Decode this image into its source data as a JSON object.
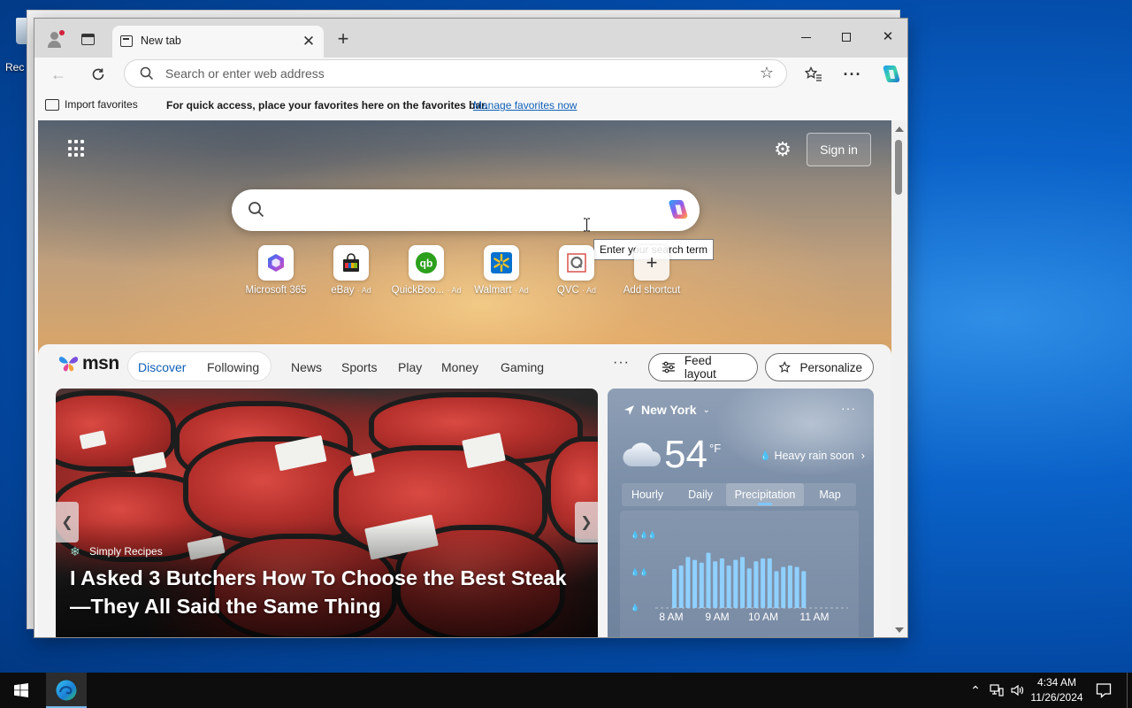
{
  "desktop": {
    "icon_label": "Rec"
  },
  "browser": {
    "tab_title": "New tab",
    "address_placeholder": "Search or enter web address",
    "favorites_bar": {
      "import_label": "Import favorites",
      "message": "For quick access, place your favorites here on the favorites bar.",
      "manage_link": "Manage favorites now"
    }
  },
  "newtab": {
    "signin_label": "Sign in",
    "tooltip": "Enter your search term",
    "shortcuts": [
      {
        "label": "Microsoft 365",
        "ad": ""
      },
      {
        "label": "eBay",
        "ad": "· Ad"
      },
      {
        "label": "QuickBoo...",
        "ad": "· Ad"
      },
      {
        "label": "Walmart",
        "ad": "· Ad"
      },
      {
        "label": "QVC",
        "ad": "· Ad"
      },
      {
        "label": "Add shortcut",
        "ad": ""
      }
    ]
  },
  "feed": {
    "logo": "msn",
    "tabs": [
      "Discover",
      "Following",
      "News",
      "Sports",
      "Play",
      "Money",
      "Gaming"
    ],
    "more": "···",
    "feed_layout_label": "Feed layout",
    "personalize_label": "Personalize",
    "hero": {
      "source": "Simply Recipes",
      "headline": "I Asked 3 Butchers How To Choose the Best Steak—They All Said the Same Thing"
    },
    "weather": {
      "location": "New York",
      "temp": "54",
      "unit": "°F",
      "alert": "Heavy rain soon",
      "tabs": [
        "Hourly",
        "Daily",
        "Precipitation",
        "Map"
      ],
      "active_tab": "Precipitation",
      "time_labels": [
        "8 AM",
        "9 AM",
        "10 AM",
        "11 AM"
      ],
      "precip_bars": [
        0.55,
        0.6,
        0.72,
        0.68,
        0.64,
        0.78,
        0.66,
        0.7,
        0.6,
        0.68,
        0.72,
        0.56,
        0.66,
        0.7,
        0.7,
        0.52,
        0.58,
        0.6,
        0.58,
        0.52
      ]
    }
  },
  "taskbar": {
    "time": "4:34 AM",
    "date": "11/26/2024"
  }
}
